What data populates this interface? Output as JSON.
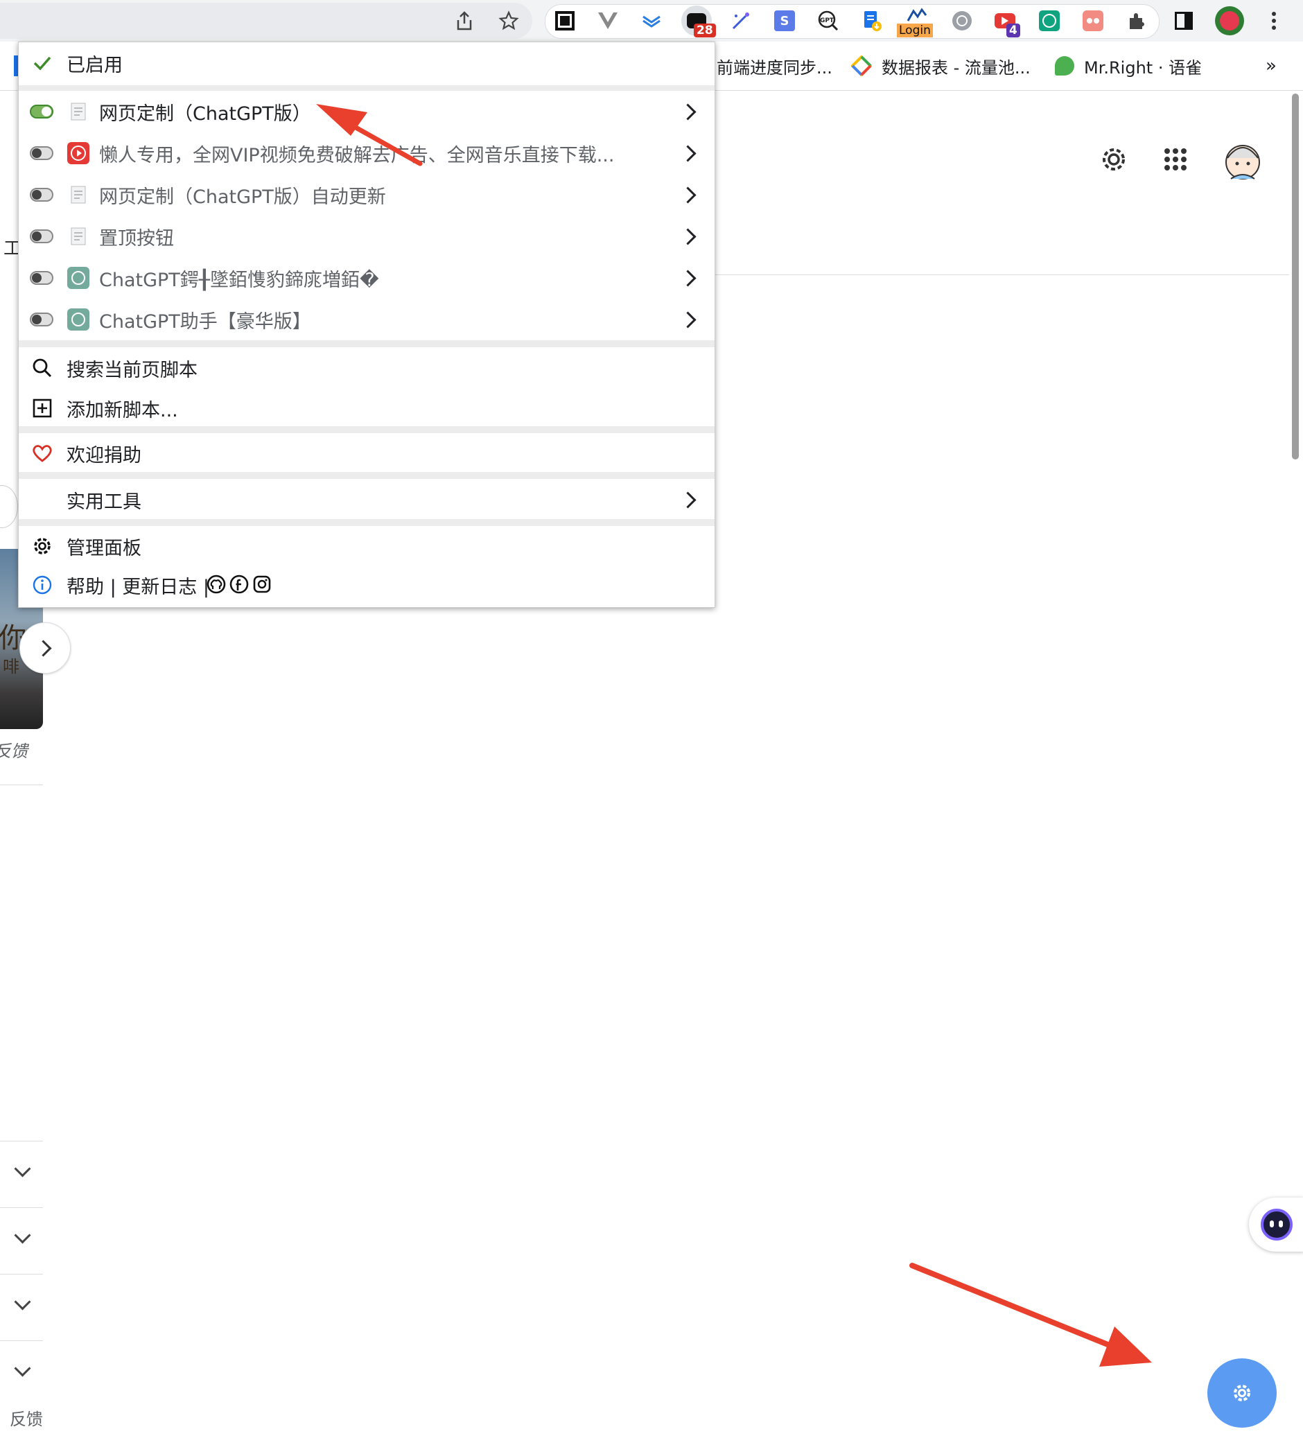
{
  "toolbar": {
    "badges": {
      "tampermonkey_count": "28",
      "youtube_count": "4",
      "login_label": "Login"
    }
  },
  "bookmarks": [
    {
      "label": "前端进度同步..."
    },
    {
      "label": "数据报表 - 流量池..."
    },
    {
      "label": "Mr.Right · 语雀"
    }
  ],
  "bookmarks_more": "»",
  "menu": {
    "enabled_header": "已启用",
    "scripts": [
      {
        "name": "网页定制（ChatGPT版）",
        "enabled": true,
        "icon": "doc-icon"
      },
      {
        "name": "懒人专用，全网VIP视频免费破解去广告、全网音乐直接下载...",
        "enabled": false,
        "icon": "video-play-icon"
      },
      {
        "name": "网页定制（ChatGPT版）自动更新",
        "enabled": false,
        "icon": "doc-icon"
      },
      {
        "name": "置顶按钮",
        "enabled": false,
        "icon": "doc-icon"
      },
      {
        "name": "ChatGPT鍔╂墜銆愯豹鍗庣増銆�",
        "enabled": false,
        "icon": "openai-icon"
      },
      {
        "name": "ChatGPT助手【豪华版】",
        "enabled": false,
        "icon": "openai-icon"
      }
    ],
    "search_label": "搜索当前页脚本",
    "add_label": "添加新脚本...",
    "donate_label": "欢迎捐助",
    "tools_label": "实用工具",
    "dashboard_label": "管理面板",
    "help_label": "帮助 | 更新日志 |"
  },
  "page": {
    "left_fragment_top": "工",
    "feedback_fragment": "反馈",
    "feedback_label": "反馈",
    "image_text_1": "你",
    "image_text_2": "啡"
  },
  "colors": {
    "accent_blue": "#5b9bf2",
    "arrow_red": "#e8402c",
    "toggle_on": "#7ab55c"
  }
}
